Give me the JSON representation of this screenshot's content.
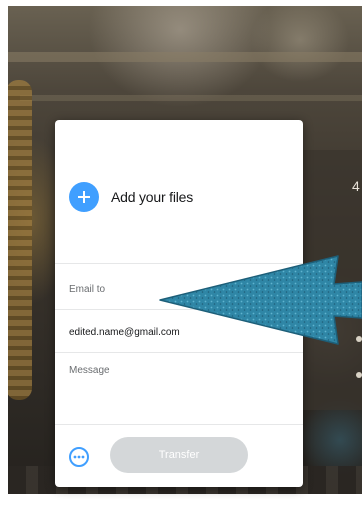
{
  "upload_card": {
    "add_files_label": "Add your files",
    "add_icon": "plus-icon",
    "email_to_placeholder": "Email to",
    "your_email_value": "edited.name@gmail.com",
    "message_placeholder": "Message",
    "options_icon": "more-options-icon",
    "transfer_label": "Transfer"
  },
  "colors": {
    "accent_blue": "#409fff",
    "transfer_disabled": "#d4d7d9",
    "annotation_arrow": "#2f86a6"
  },
  "icons": {
    "annotation": "arrow-left-icon"
  }
}
